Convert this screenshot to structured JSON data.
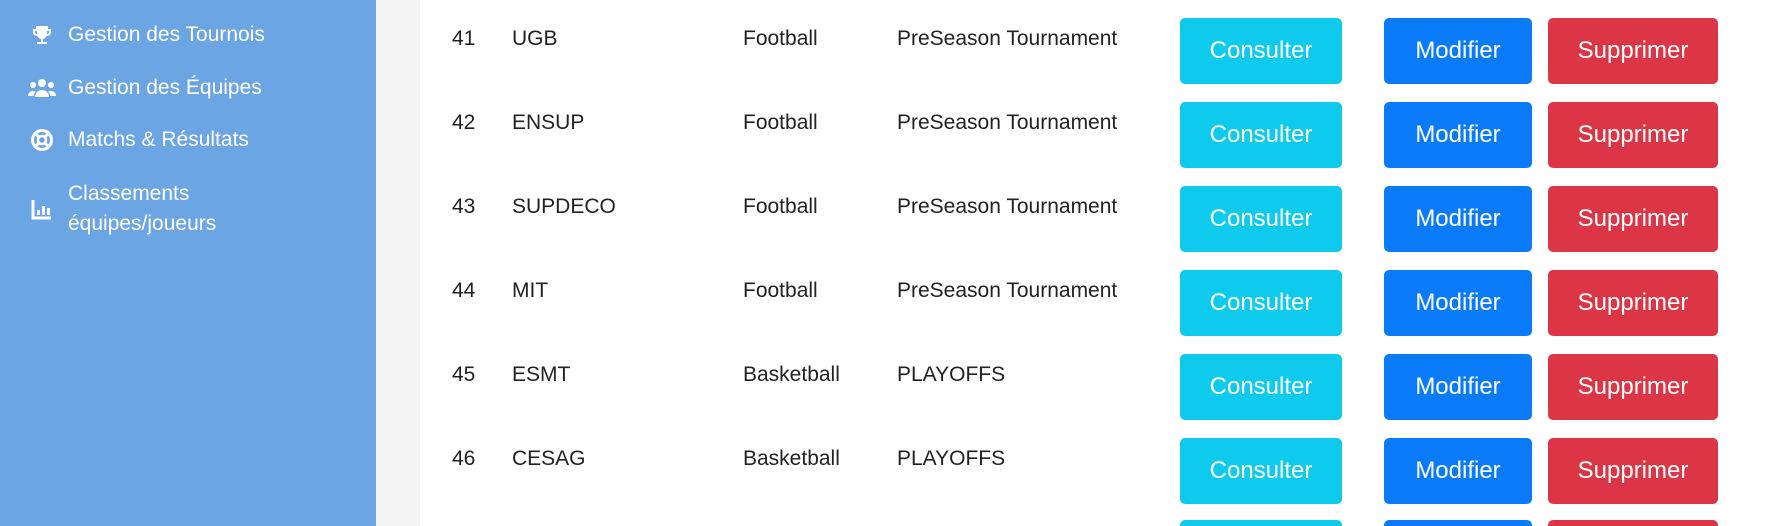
{
  "sidebar": {
    "items": [
      {
        "label": "Gestion des Tournois",
        "icon": "trophy-icon"
      },
      {
        "label": "Gestion des Équipes",
        "icon": "users-icon"
      },
      {
        "label": "Matchs & Résultats",
        "icon": "lifebuoy-icon"
      },
      {
        "label": "Classements équipes/joueurs",
        "icon": "bar-chart-icon"
      }
    ]
  },
  "table": {
    "rows": [
      {
        "id": "41",
        "name": "UGB",
        "sport": "Football",
        "tournament": "PreSeason Tournament"
      },
      {
        "id": "42",
        "name": "ENSUP",
        "sport": "Football",
        "tournament": "PreSeason Tournament"
      },
      {
        "id": "43",
        "name": "SUPDECO",
        "sport": "Football",
        "tournament": "PreSeason Tournament"
      },
      {
        "id": "44",
        "name": "MIT",
        "sport": "Football",
        "tournament": "PreSeason Tournament"
      },
      {
        "id": "45",
        "name": "ESMT",
        "sport": "Basketball",
        "tournament": "PLAYOFFS"
      },
      {
        "id": "46",
        "name": "CESAG",
        "sport": "Basketball",
        "tournament": "PLAYOFFS"
      }
    ]
  },
  "actions": {
    "view_label": "Consulter",
    "edit_label": "Modifier",
    "delete_label": "Supprimer"
  },
  "colors": {
    "sidebar_bg": "#6ba5e3",
    "info": "#0ecbee",
    "primary": "#0a7bf8",
    "danger": "#dc3545"
  }
}
